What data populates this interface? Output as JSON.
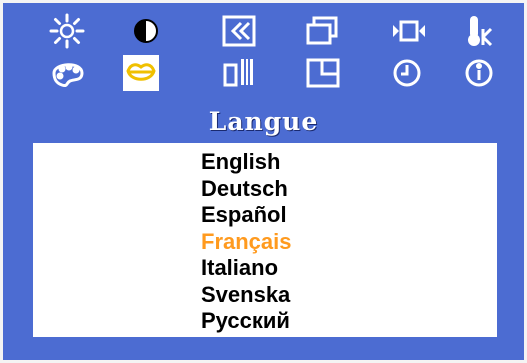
{
  "menu": {
    "title": "Langue",
    "top_icons": [
      {
        "name": "brightness-icon"
      },
      {
        "name": "contrast-icon"
      },
      {
        "name": "horizontal-position-icon"
      },
      {
        "name": "size-icon"
      },
      {
        "name": "video-input-icon"
      },
      {
        "name": "color-temperature-icon"
      }
    ],
    "bottom_icons": [
      {
        "name": "color-palette-icon"
      },
      {
        "name": "language-icon",
        "selected": true
      },
      {
        "name": "sharpness-icon"
      },
      {
        "name": "osd-position-icon"
      },
      {
        "name": "osd-timeout-icon"
      },
      {
        "name": "information-icon"
      }
    ]
  },
  "languages": [
    {
      "label": "English"
    },
    {
      "label": "Deutsch"
    },
    {
      "label": "Español"
    },
    {
      "label": "Français",
      "selected": true
    },
    {
      "label": "Italiano"
    },
    {
      "label": "Svenska"
    },
    {
      "label": "Русский"
    }
  ],
  "colors": {
    "background": "#4c6cd2",
    "border": "#f4f4f4",
    "panel": "#ffffff",
    "text": "#000000",
    "highlight": "#ff9a1e",
    "icon_stroke": "#ffffff",
    "selected_icon_stroke": "#f0c000"
  }
}
